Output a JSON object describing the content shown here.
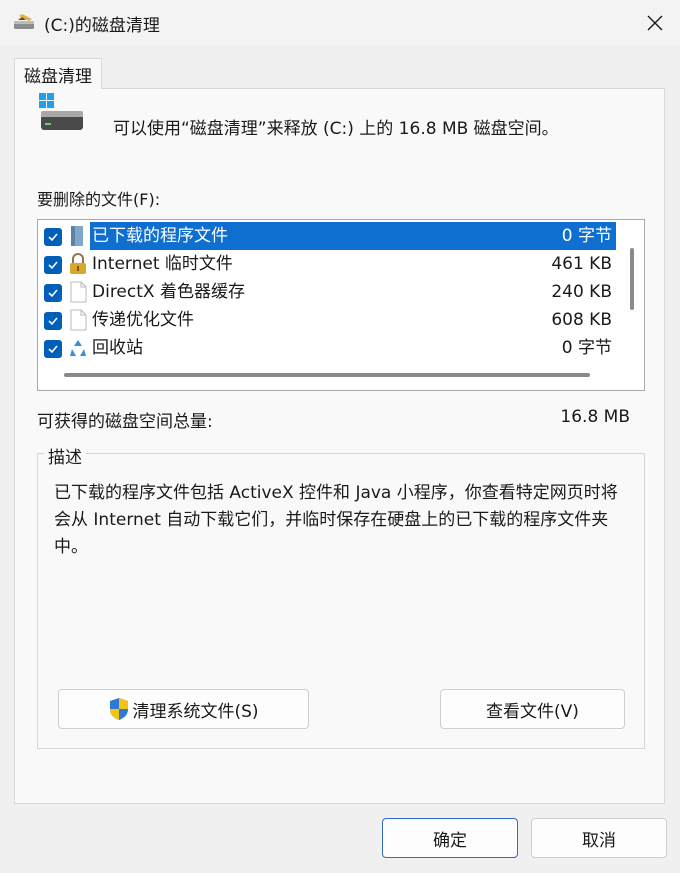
{
  "window": {
    "title": "(C:)的磁盘清理"
  },
  "tab": {
    "label": "磁盘清理"
  },
  "summary_text": "可以使用“磁盘清理”来释放  (C:) 上的 16.8 MB 磁盘空间。",
  "files_label": "要删除的文件(F):",
  "files": [
    {
      "name": "已下载的程序文件",
      "size": "0 字节",
      "checked": true,
      "selected": true,
      "icon": "folder-icon"
    },
    {
      "name": "Internet 临时文件",
      "size": "461 KB",
      "checked": true,
      "selected": false,
      "icon": "lock-icon"
    },
    {
      "name": "DirectX 着色器缓存",
      "size": "240 KB",
      "checked": true,
      "selected": false,
      "icon": "document-icon"
    },
    {
      "name": "传递优化文件",
      "size": "608 KB",
      "checked": true,
      "selected": false,
      "icon": "document-icon"
    },
    {
      "name": "回收站",
      "size": "0 字节",
      "checked": true,
      "selected": false,
      "icon": "recycle-bin-icon"
    }
  ],
  "total": {
    "label": "可获得的磁盘空间总量:",
    "value": "16.8 MB"
  },
  "description": {
    "title": "描述",
    "text": "已下载的程序文件包括 ActiveX 控件和 Java 小程序，你查看特定网页时将会从 Internet 自动下载它们，并临时保存在硬盘上的已下载的程序文件夹中。"
  },
  "buttons": {
    "clean_system_label": "清理系统文件(S)",
    "view_files_label": "查看文件(V)",
    "ok_label": "确定",
    "cancel_label": "取消"
  },
  "colors": {
    "selection": "#0e6fd0",
    "checkbox": "#005fb8",
    "shield_blue": "#2b78d6",
    "shield_yellow": "#f2c511"
  }
}
